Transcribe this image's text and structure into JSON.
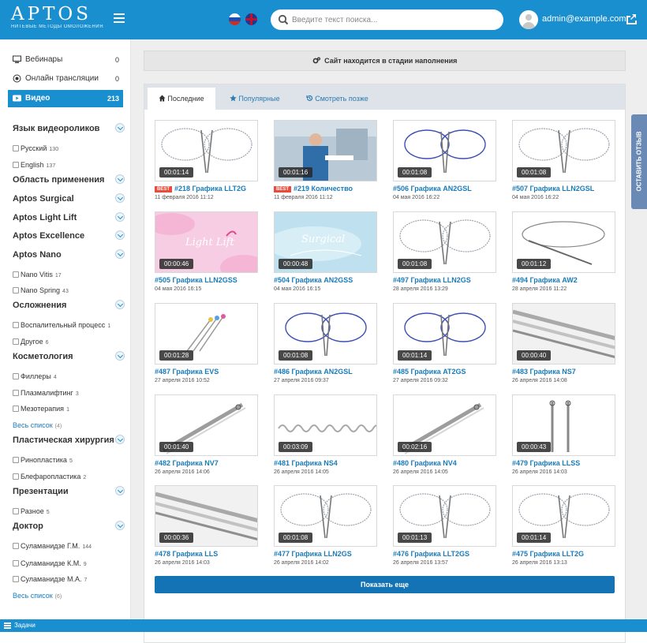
{
  "header": {
    "logo": "APTOS",
    "tagline": "нитевые методы омоложения",
    "search_placeholder": "Введите текст поиска...",
    "user_email": "admin@example.com",
    "accent": "#1a8fd0"
  },
  "sidebar": {
    "nav": [
      {
        "label": "Вебинары",
        "count": "0",
        "icon": "monitor-icon"
      },
      {
        "label": "Онлайн трансляции",
        "count": "0",
        "icon": "broadcast-icon"
      },
      {
        "label": "Видео",
        "count": "213",
        "icon": "play-icon",
        "active": true
      }
    ],
    "sections": [
      {
        "title": "Язык видеороликов",
        "items": [
          {
            "label": "Русский",
            "count": "130"
          },
          {
            "label": "English",
            "count": "137"
          }
        ]
      },
      {
        "title": "Область применения",
        "items": []
      },
      {
        "title": "Aptos Surgical",
        "items": []
      },
      {
        "title": "Aptos Light Lift",
        "items": []
      },
      {
        "title": "Aptos Excellence",
        "items": []
      },
      {
        "title": "Aptos Nano",
        "items": [
          {
            "label": "Nano Vitis",
            "count": "17"
          },
          {
            "label": "Nano Spring",
            "count": "43"
          }
        ]
      },
      {
        "title": "Осложнения",
        "items": [
          {
            "label": "Воспалительный процесс",
            "count": "1"
          },
          {
            "label": "Другое",
            "count": "6"
          }
        ]
      },
      {
        "title": "Косметология",
        "items": [
          {
            "label": "Филлеры",
            "count": "4"
          },
          {
            "label": "Плазмалифтинг",
            "count": "3"
          },
          {
            "label": "Мезотерапия",
            "count": "1"
          }
        ],
        "all_link": {
          "label": "Весь список",
          "count": "(4)"
        }
      },
      {
        "title": "Пластическая хирургия",
        "items": [
          {
            "label": "Ринопластика",
            "count": "5"
          },
          {
            "label": "Блефаропластика",
            "count": "2"
          }
        ]
      },
      {
        "title": "Презентации",
        "items": [
          {
            "label": "Разное",
            "count": "5"
          }
        ]
      },
      {
        "title": "Доктор",
        "items": [
          {
            "label": "Суламанидзе Г.М.",
            "count": "144"
          },
          {
            "label": "Суламанидзе К.М.",
            "count": "9"
          },
          {
            "label": "Суламанидзе М.А.",
            "count": "7"
          }
        ],
        "all_link": {
          "label": "Весь список",
          "count": "(6)"
        }
      }
    ]
  },
  "main": {
    "notice": "Сайт находится в стадии наполнения",
    "tabs": [
      {
        "label": "Последние",
        "icon": "home-icon",
        "active": true
      },
      {
        "label": "Популярные",
        "icon": "star-icon"
      },
      {
        "label": "Смотреть позже",
        "icon": "history-icon"
      }
    ],
    "videos": [
      {
        "title": "#218 Графика LLT2G",
        "date": "11 февраля 2016 11:12",
        "duration": "00:01:14",
        "best": "BEST",
        "thumb": "loop-grey"
      },
      {
        "title": "#219 Количество",
        "date": "11 февраля 2016 11:12",
        "duration": "00:01:16",
        "best": "BEST",
        "thumb": "photo"
      },
      {
        "title": "#506 Графика AN2GSL",
        "date": "04 мая 2016 16:22",
        "duration": "00:01:08",
        "thumb": "loop-blue"
      },
      {
        "title": "#507 Графика LLN2GSL",
        "date": "04 мая 2016 16:22",
        "duration": "00:01:08",
        "thumb": "loop-grey"
      },
      {
        "title": "#505 Графика LLN2GSS",
        "date": "04 мая 2016 16:15",
        "duration": "00:00:46",
        "thumb": "lightlift"
      },
      {
        "title": "#504 Графика AN2GSS",
        "date": "04 мая 2016 16:15",
        "duration": "00:00:48",
        "thumb": "surgical"
      },
      {
        "title": "#497 Графика LLN2GS",
        "date": "28 апреля 2016 13:29",
        "duration": "00:01:08",
        "thumb": "loop-grey"
      },
      {
        "title": "#494 Графика AW2",
        "date": "28 апреля 2016 11:22",
        "duration": "00:01:12",
        "thumb": "single-loop"
      },
      {
        "title": "#487 Графика EVS",
        "date": "27 апреля 2016 10:52",
        "duration": "00:01:28",
        "thumb": "needles-color"
      },
      {
        "title": "#486 Графика AN2GSL",
        "date": "27 апреля 2016 09:37",
        "duration": "00:01:08",
        "thumb": "loop-blue"
      },
      {
        "title": "#485 Графика AT2GS",
        "date": "27 апреля 2016 09:32",
        "duration": "00:01:14",
        "thumb": "loop-blue"
      },
      {
        "title": "#483 Графика NS7",
        "date": "26 апреля 2016 14:08",
        "duration": "00:00:40",
        "thumb": "rods"
      },
      {
        "title": "#482 Графика NV7",
        "date": "26 апреля 2016 14:06",
        "duration": "00:01:40",
        "thumb": "needle-diag"
      },
      {
        "title": "#481 Графика NS4",
        "date": "26 апреля 2016 14:05",
        "duration": "00:03:09",
        "thumb": "spring"
      },
      {
        "title": "#480 Графика NV4",
        "date": "26 апреля 2016 14:05",
        "duration": "00:02:16",
        "thumb": "needle-diag"
      },
      {
        "title": "#479 Графика LLSS",
        "date": "26 апреля 2016 14:03",
        "duration": "00:00:43",
        "thumb": "needle-pair"
      },
      {
        "title": "#478 Графика LLS",
        "date": "26 апреля 2016 14:03",
        "duration": "00:00:36",
        "thumb": "rods"
      },
      {
        "title": "#477 Графика LLN2GS",
        "date": "26 апреля 2016 14:02",
        "duration": "00:01:08",
        "thumb": "loop-grey"
      },
      {
        "title": "#476 Графика LLT2GS",
        "date": "26 апреля 2016 13:57",
        "duration": "00:01:13",
        "thumb": "loop-grey"
      },
      {
        "title": "#475 Графика LLT2G",
        "date": "26 апреля 2016 13:13",
        "duration": "00:01:14",
        "thumb": "loop-grey"
      }
    ],
    "load_more": "Показать еще"
  },
  "feedback_label": "ОСТАВИТЬ ОТЗЫВ",
  "taskbar_label": "Задачи"
}
